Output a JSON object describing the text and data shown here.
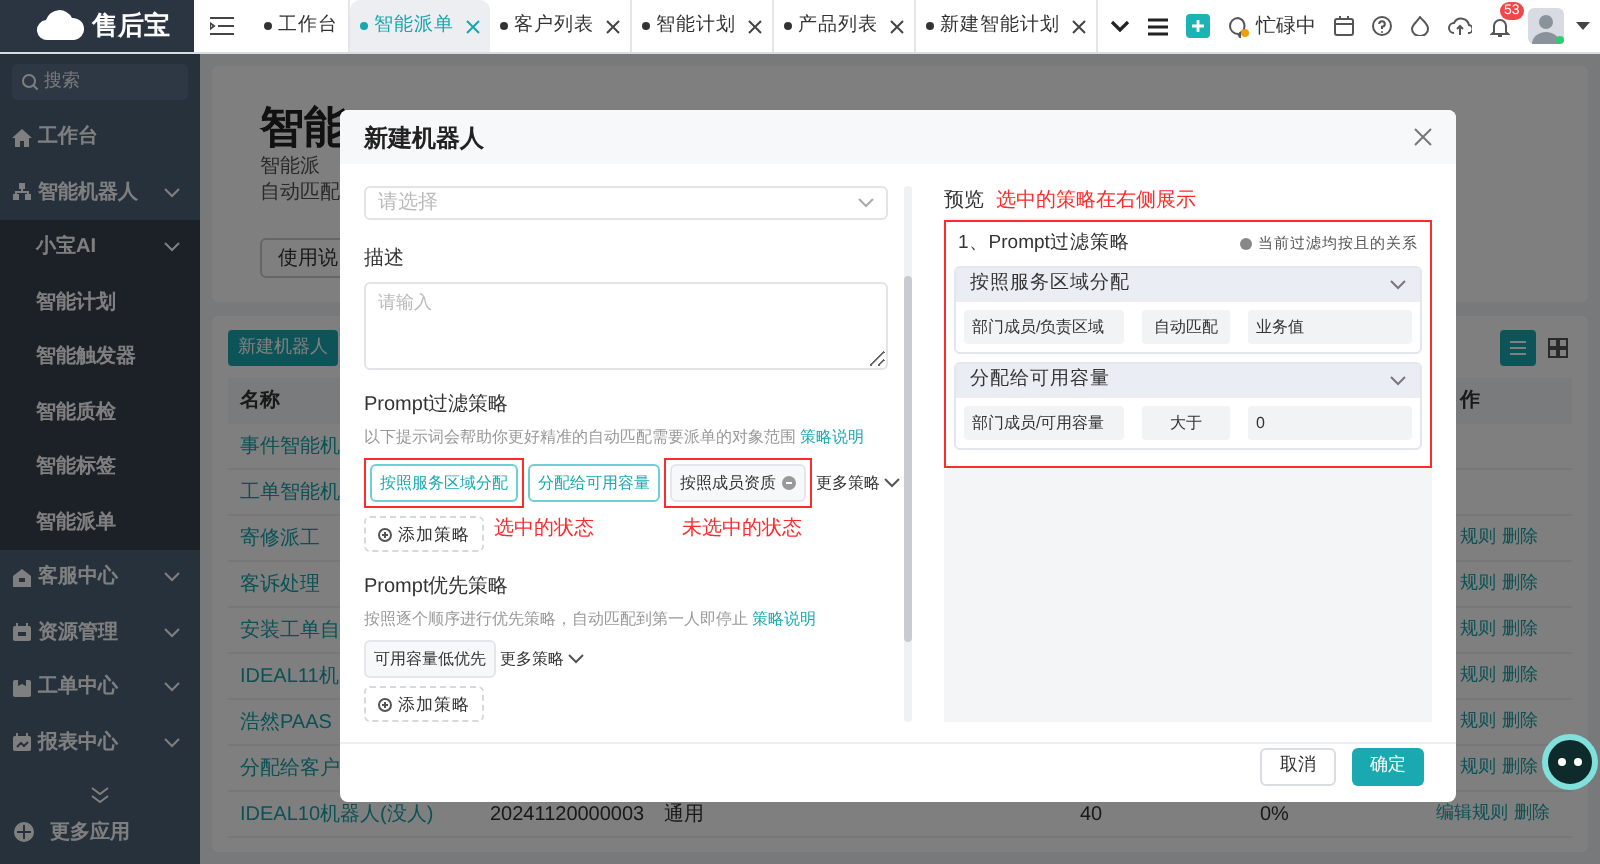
{
  "app": {
    "logo": "售后宝"
  },
  "tabs": [
    {
      "label": "工作台",
      "closable": false,
      "selected": false
    },
    {
      "label": "智能派单",
      "closable": true,
      "selected": true
    },
    {
      "label": "客户列表",
      "closable": true,
      "selected": false
    },
    {
      "label": "智能计划",
      "closable": true,
      "selected": false
    },
    {
      "label": "产品列表",
      "closable": true,
      "selected": false
    },
    {
      "label": "新建智能计划",
      "closable": true,
      "selected": false
    }
  ],
  "header_tools": {
    "status": "忙碌中",
    "notification_count": "53"
  },
  "sidebar": {
    "search_placeholder": "搜索",
    "more": "更多应用",
    "items": [
      {
        "label": "工作台",
        "kind": "home",
        "has_submenu": false
      },
      {
        "label": "智能机器人",
        "kind": "robot",
        "has_submenu": true,
        "children": [
          {
            "label": "小宝AI",
            "has_submenu": true
          },
          {
            "label": "智能计划",
            "has_submenu": false
          },
          {
            "label": "智能触发器",
            "has_submenu": false
          },
          {
            "label": "智能质检",
            "has_submenu": false
          },
          {
            "label": "智能标签",
            "has_submenu": false
          },
          {
            "label": "智能派单",
            "has_submenu": false
          }
        ]
      },
      {
        "label": "客服中心",
        "kind": "service",
        "has_submenu": true
      },
      {
        "label": "资源管理",
        "kind": "resource",
        "has_submenu": true
      },
      {
        "label": "工单中心",
        "kind": "ticket",
        "has_submenu": true
      },
      {
        "label": "报表中心",
        "kind": "report",
        "has_submenu": true
      }
    ]
  },
  "page": {
    "title": "智能",
    "description": [
      "智能派",
      "自动匹配"
    ],
    "help_button": "使用说"
  },
  "table": {
    "new_button": "新建机器人",
    "columns": [
      "名称",
      "作"
    ],
    "rows": [
      {
        "name": "事件智能机",
        "actions": []
      },
      {
        "name": "工单智能机",
        "actions": []
      },
      {
        "name": "寄修派工",
        "actions": [
          "规则",
          "删除"
        ]
      },
      {
        "name": "客诉处理",
        "actions": [
          "规则",
          "删除"
        ]
      },
      {
        "name": "安装工单自",
        "actions": [
          "规则",
          "删除"
        ]
      },
      {
        "name": "IDEAL11机",
        "actions": [
          "规则",
          "删除"
        ]
      },
      {
        "name": "浩然PAAS",
        "actions": [
          "规则",
          "删除"
        ]
      },
      {
        "name": "分配给客户",
        "actions": [
          "规则",
          "删除"
        ]
      },
      {
        "name": "IDEAL10机器人(没人)",
        "id": "20241120000003",
        "type": "通用",
        "count": "40",
        "rate": "0%",
        "actions": [
          "编辑规则",
          "删除"
        ]
      }
    ]
  },
  "dialog": {
    "title": "新建机器人",
    "select": {
      "placeholder": "请选择"
    },
    "description": {
      "label": "描述",
      "placeholder": "请输入"
    },
    "filter_policy": {
      "title": "Prompt过滤策略",
      "hint": "以下提示词会帮助你更好精准的自动匹配需要派单的对象范围",
      "link": "策略说明",
      "more": "更多策略",
      "add": "添加策略",
      "options": [
        {
          "label": "按照服务区域分配",
          "selected": true,
          "annotated": true,
          "has_info": false
        },
        {
          "label": "分配给可用容量",
          "selected": true,
          "annotated": false,
          "has_info": false
        },
        {
          "label": "按照成员资质",
          "selected": false,
          "annotated": true,
          "has_info": true
        }
      ]
    },
    "priority_policy": {
      "title": "Prompt优先策略",
      "hint": "按照逐个顺序进行优先策略，自动匹配到第一人即停止",
      "link": "策略说明",
      "more": "更多策略",
      "add": "添加策略",
      "options": [
        {
          "label": "可用容量低优先",
          "selected": false,
          "annotated": false,
          "has_info": false
        }
      ]
    },
    "preview": {
      "label": "预览",
      "section_title": "1、Prompt过滤策略",
      "note": "当前过滤均按且的关系",
      "groups": [
        {
          "title": "按照服务区域分配",
          "fields": [
            "部门成员/负责区域",
            "自动匹配",
            "业务值"
          ]
        },
        {
          "title": "分配给可用容量",
          "fields": [
            "部门成员/可用容量",
            "大于",
            "0"
          ]
        }
      ]
    },
    "annotations": [
      "选中的状态",
      "未选中的状态",
      "选中的策略在右侧展示"
    ],
    "buttons": [
      {
        "label": "取消",
        "primary": false
      },
      {
        "label": "确定",
        "primary": true
      }
    ]
  }
}
